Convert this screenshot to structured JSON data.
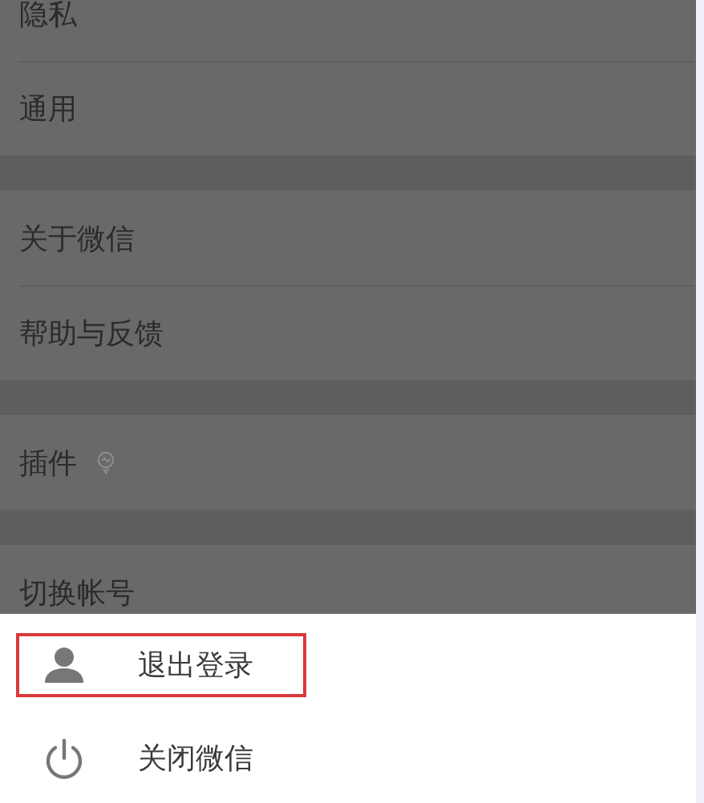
{
  "settings_groups": [
    {
      "items": [
        {
          "label": "隐私"
        },
        {
          "label": "通用"
        }
      ]
    },
    {
      "items": [
        {
          "label": "关于微信"
        },
        {
          "label": "帮助与反馈"
        }
      ]
    },
    {
      "items": [
        {
          "label": "插件",
          "kind": "badge"
        }
      ]
    },
    {
      "items": [
        {
          "label": "切换帐号"
        }
      ]
    }
  ],
  "action_sheet": {
    "items": [
      {
        "label": "退出登录",
        "kind": "person",
        "highlighted": true
      },
      {
        "label": "关闭微信",
        "kind": "power",
        "highlighted": false
      }
    ]
  }
}
